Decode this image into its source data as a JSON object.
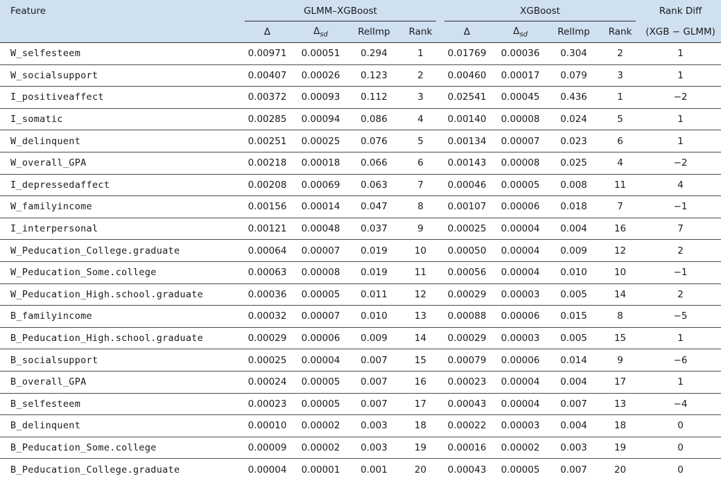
{
  "header": {
    "feature": "Feature",
    "group_glmm": "GLMM–XGBoost",
    "group_xgb": "XGBoost",
    "rank_diff": "Rank Diff",
    "rank_diff_sub": "(XGB − GLMM)",
    "delta": "Δ",
    "delta_sd_sub": "sd",
    "relimp": "RelImp",
    "rank": "Rank"
  },
  "rows": [
    {
      "feature": "W_selfesteem",
      "g_delta": "0.00971",
      "g_sd": "0.00051",
      "g_rel": "0.294",
      "g_rank": "1",
      "x_delta": "0.01769",
      "x_sd": "0.00036",
      "x_rel": "0.304",
      "x_rank": "2",
      "diff": "1"
    },
    {
      "feature": "W_socialsupport",
      "g_delta": "0.00407",
      "g_sd": "0.00026",
      "g_rel": "0.123",
      "g_rank": "2",
      "x_delta": "0.00460",
      "x_sd": "0.00017",
      "x_rel": "0.079",
      "x_rank": "3",
      "diff": "1"
    },
    {
      "feature": "I_positiveaffect",
      "g_delta": "0.00372",
      "g_sd": "0.00093",
      "g_rel": "0.112",
      "g_rank": "3",
      "x_delta": "0.02541",
      "x_sd": "0.00045",
      "x_rel": "0.436",
      "x_rank": "1",
      "diff": "−2"
    },
    {
      "feature": "I_somatic",
      "g_delta": "0.00285",
      "g_sd": "0.00094",
      "g_rel": "0.086",
      "g_rank": "4",
      "x_delta": "0.00140",
      "x_sd": "0.00008",
      "x_rel": "0.024",
      "x_rank": "5",
      "diff": "1"
    },
    {
      "feature": "W_delinquent",
      "g_delta": "0.00251",
      "g_sd": "0.00025",
      "g_rel": "0.076",
      "g_rank": "5",
      "x_delta": "0.00134",
      "x_sd": "0.00007",
      "x_rel": "0.023",
      "x_rank": "6",
      "diff": "1"
    },
    {
      "feature": "W_overall_GPA",
      "g_delta": "0.00218",
      "g_sd": "0.00018",
      "g_rel": "0.066",
      "g_rank": "6",
      "x_delta": "0.00143",
      "x_sd": "0.00008",
      "x_rel": "0.025",
      "x_rank": "4",
      "diff": "−2"
    },
    {
      "feature": "I_depressedaffect",
      "g_delta": "0.00208",
      "g_sd": "0.00069",
      "g_rel": "0.063",
      "g_rank": "7",
      "x_delta": "0.00046",
      "x_sd": "0.00005",
      "x_rel": "0.008",
      "x_rank": "11",
      "diff": "4"
    },
    {
      "feature": "W_familyincome",
      "g_delta": "0.00156",
      "g_sd": "0.00014",
      "g_rel": "0.047",
      "g_rank": "8",
      "x_delta": "0.00107",
      "x_sd": "0.00006",
      "x_rel": "0.018",
      "x_rank": "7",
      "diff": "−1"
    },
    {
      "feature": "I_interpersonal",
      "g_delta": "0.00121",
      "g_sd": "0.00048",
      "g_rel": "0.037",
      "g_rank": "9",
      "x_delta": "0.00025",
      "x_sd": "0.00004",
      "x_rel": "0.004",
      "x_rank": "16",
      "diff": "7"
    },
    {
      "feature": "W_Peducation_College.graduate",
      "g_delta": "0.00064",
      "g_sd": "0.00007",
      "g_rel": "0.019",
      "g_rank": "10",
      "x_delta": "0.00050",
      "x_sd": "0.00004",
      "x_rel": "0.009",
      "x_rank": "12",
      "diff": "2"
    },
    {
      "feature": "W_Peducation_Some.college",
      "g_delta": "0.00063",
      "g_sd": "0.00008",
      "g_rel": "0.019",
      "g_rank": "11",
      "x_delta": "0.00056",
      "x_sd": "0.00004",
      "x_rel": "0.010",
      "x_rank": "10",
      "diff": "−1"
    },
    {
      "feature": "W_Peducation_High.school.graduate",
      "g_delta": "0.00036",
      "g_sd": "0.00005",
      "g_rel": "0.011",
      "g_rank": "12",
      "x_delta": "0.00029",
      "x_sd": "0.00003",
      "x_rel": "0.005",
      "x_rank": "14",
      "diff": "2"
    },
    {
      "feature": "B_familyincome",
      "g_delta": "0.00032",
      "g_sd": "0.00007",
      "g_rel": "0.010",
      "g_rank": "13",
      "x_delta": "0.00088",
      "x_sd": "0.00006",
      "x_rel": "0.015",
      "x_rank": "8",
      "diff": "−5"
    },
    {
      "feature": "B_Peducation_High.school.graduate",
      "g_delta": "0.00029",
      "g_sd": "0.00006",
      "g_rel": "0.009",
      "g_rank": "14",
      "x_delta": "0.00029",
      "x_sd": "0.00003",
      "x_rel": "0.005",
      "x_rank": "15",
      "diff": "1"
    },
    {
      "feature": "B_socialsupport",
      "g_delta": "0.00025",
      "g_sd": "0.00004",
      "g_rel": "0.007",
      "g_rank": "15",
      "x_delta": "0.00079",
      "x_sd": "0.00006",
      "x_rel": "0.014",
      "x_rank": "9",
      "diff": "−6"
    },
    {
      "feature": "B_overall_GPA",
      "g_delta": "0.00024",
      "g_sd": "0.00005",
      "g_rel": "0.007",
      "g_rank": "16",
      "x_delta": "0.00023",
      "x_sd": "0.00004",
      "x_rel": "0.004",
      "x_rank": "17",
      "diff": "1"
    },
    {
      "feature": "B_selfesteem",
      "g_delta": "0.00023",
      "g_sd": "0.00005",
      "g_rel": "0.007",
      "g_rank": "17",
      "x_delta": "0.00043",
      "x_sd": "0.00004",
      "x_rel": "0.007",
      "x_rank": "13",
      "diff": "−4"
    },
    {
      "feature": "B_delinquent",
      "g_delta": "0.00010",
      "g_sd": "0.00002",
      "g_rel": "0.003",
      "g_rank": "18",
      "x_delta": "0.00022",
      "x_sd": "0.00003",
      "x_rel": "0.004",
      "x_rank": "18",
      "diff": "0"
    },
    {
      "feature": "B_Peducation_Some.college",
      "g_delta": "0.00009",
      "g_sd": "0.00002",
      "g_rel": "0.003",
      "g_rank": "19",
      "x_delta": "0.00016",
      "x_sd": "0.00002",
      "x_rel": "0.003",
      "x_rank": "19",
      "diff": "0"
    },
    {
      "feature": "B_Peducation_College.graduate",
      "g_delta": "0.00004",
      "g_sd": "0.00001",
      "g_rel": "0.001",
      "g_rank": "20",
      "x_delta": "0.00043",
      "x_sd": "0.00005",
      "x_rel": "0.007",
      "x_rank": "20",
      "diff": "0"
    }
  ]
}
